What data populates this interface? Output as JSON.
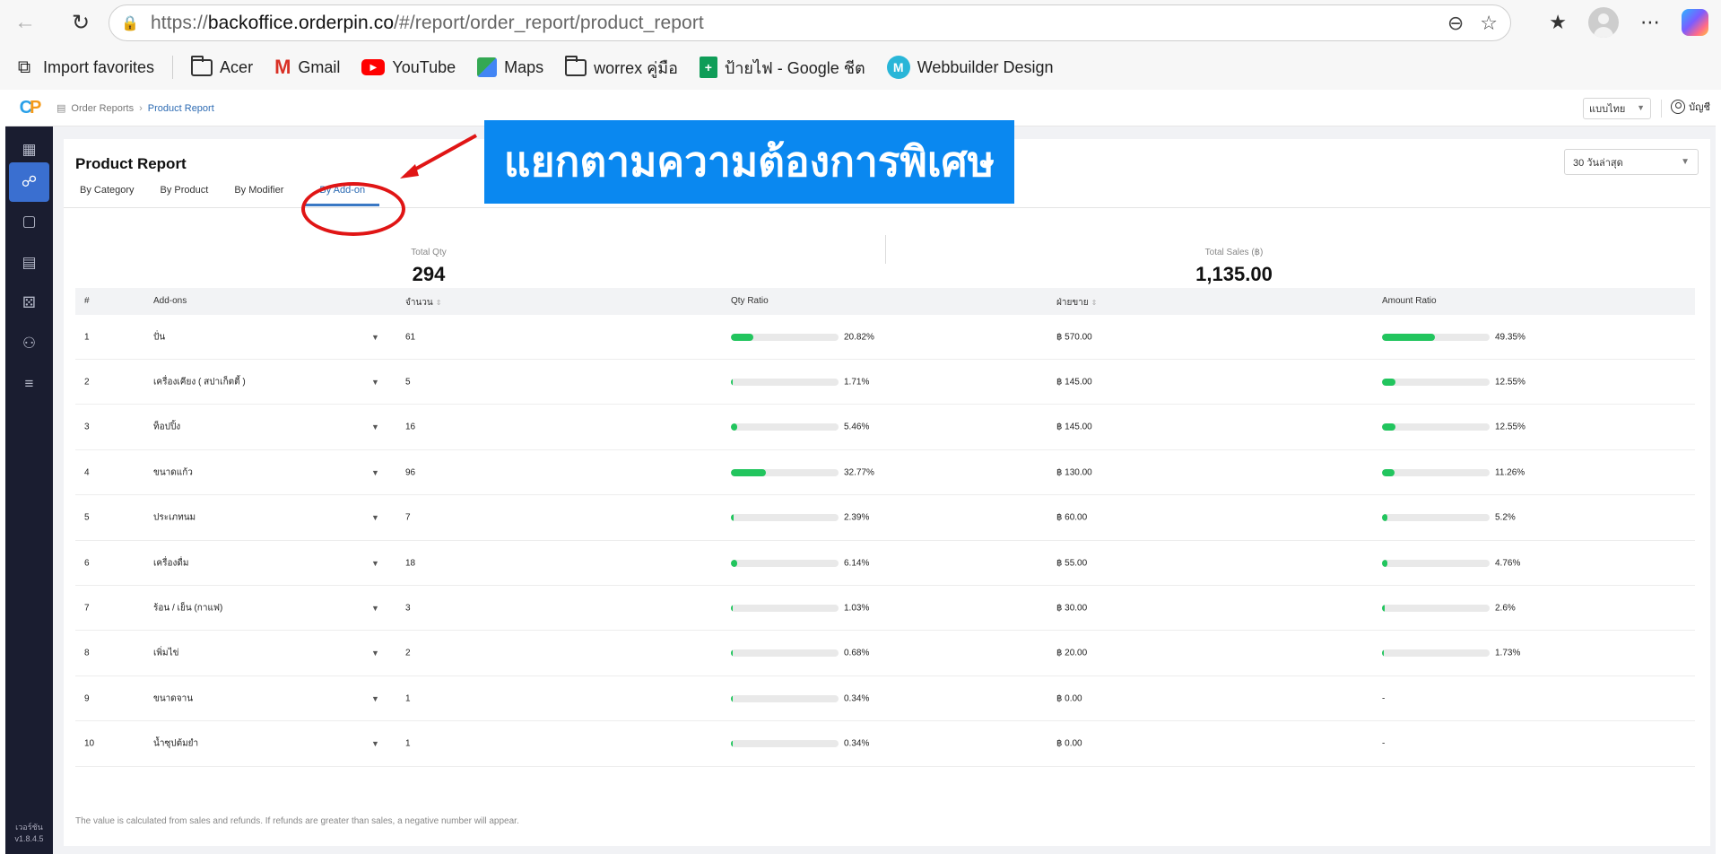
{
  "browser": {
    "url_prefix": "https://",
    "url_host": "backoffice.orderpin.co",
    "url_path": "/#/report/order_report/product_report",
    "bookmarks": [
      {
        "label": "Import favorites",
        "icon": "import-icon"
      },
      {
        "label": "Acer",
        "icon": "folder-icon"
      },
      {
        "label": "Gmail",
        "icon": "gmail-icon"
      },
      {
        "label": "YouTube",
        "icon": "youtube-icon"
      },
      {
        "label": "Maps",
        "icon": "maps-icon"
      },
      {
        "label": "worrex คู่มือ",
        "icon": "folder-icon"
      },
      {
        "label": "ป้ายไฟ - Google ชีต",
        "icon": "sheets-icon"
      },
      {
        "label": "Webbuilder Design",
        "icon": "webbuilder-icon"
      }
    ]
  },
  "header": {
    "breadcrumb": [
      "Order Reports",
      "Product Report"
    ],
    "language": "แบบไทย",
    "account": "บัญชี"
  },
  "sidebar": {
    "items": [
      "grid-icon",
      "report-icon",
      "bag-icon",
      "list-icon",
      "users-icon",
      "user-settings-icon",
      "sliders-icon"
    ],
    "active_index": 1,
    "version_label": "เวอร์ชัน",
    "version": "v1.8.4.5"
  },
  "page": {
    "title": "Product Report",
    "tabs": [
      "By Category",
      "By Product",
      "By Modifier",
      "By Add-on"
    ],
    "active_tab": 3,
    "date_range": "30 วันล่าสุด",
    "callout": "แยกตามความต้องการพิเศษ",
    "stats": {
      "total_qty_label": "Total Qty",
      "total_qty": "294",
      "total_sales_label": "Total Sales (฿)",
      "total_sales": "1,135.00"
    },
    "columns": [
      "#",
      "Add-ons",
      "จำนวน",
      "Qty Ratio",
      "ฝ่ายขาย",
      "Amount Ratio"
    ],
    "rows": [
      {
        "no": "1",
        "name": "ปั่น",
        "qty": "61",
        "qty_ratio": "20.82%",
        "qty_fill": 0.2082,
        "sales": "฿ 570.00",
        "amount_ratio": "49.35%",
        "amount_fill": 0.4935
      },
      {
        "no": "2",
        "name": "เครื่องเคียง ( สปาเก็ตตี้ )",
        "qty": "5",
        "qty_ratio": "1.71%",
        "qty_fill": 0.0171,
        "sales": "฿ 145.00",
        "amount_ratio": "12.55%",
        "amount_fill": 0.1255
      },
      {
        "no": "3",
        "name": "ท็อปปิ้ง",
        "qty": "16",
        "qty_ratio": "5.46%",
        "qty_fill": 0.0546,
        "sales": "฿ 145.00",
        "amount_ratio": "12.55%",
        "amount_fill": 0.1255
      },
      {
        "no": "4",
        "name": "ขนาดแก้ว",
        "qty": "96",
        "qty_ratio": "32.77%",
        "qty_fill": 0.3277,
        "sales": "฿ 130.00",
        "amount_ratio": "11.26%",
        "amount_fill": 0.1126
      },
      {
        "no": "5",
        "name": "ประเภทนม",
        "qty": "7",
        "qty_ratio": "2.39%",
        "qty_fill": 0.0239,
        "sales": "฿ 60.00",
        "amount_ratio": "5.2%",
        "amount_fill": 0.052
      },
      {
        "no": "6",
        "name": "เครื่องดื่ม",
        "qty": "18",
        "qty_ratio": "6.14%",
        "qty_fill": 0.0614,
        "sales": "฿ 55.00",
        "amount_ratio": "4.76%",
        "amount_fill": 0.0476
      },
      {
        "no": "7",
        "name": "ร้อน / เย็น (กาแฟ)",
        "qty": "3",
        "qty_ratio": "1.03%",
        "qty_fill": 0.0103,
        "sales": "฿ 30.00",
        "amount_ratio": "2.6%",
        "amount_fill": 0.026
      },
      {
        "no": "8",
        "name": "เพิ่มไข่",
        "qty": "2",
        "qty_ratio": "0.68%",
        "qty_fill": 0.0068,
        "sales": "฿ 20.00",
        "amount_ratio": "1.73%",
        "amount_fill": 0.0173
      },
      {
        "no": "9",
        "name": "ขนาดจาน",
        "qty": "1",
        "qty_ratio": "0.34%",
        "qty_fill": 0.0034,
        "sales": "฿ 0.00",
        "amount_ratio": "-",
        "amount_fill": null
      },
      {
        "no": "10",
        "name": "น้ำซุปต้มยำ",
        "qty": "1",
        "qty_ratio": "0.34%",
        "qty_fill": 0.0034,
        "sales": "฿ 0.00",
        "amount_ratio": "-",
        "amount_fill": null
      }
    ],
    "footnote": "The value is calculated from sales and refunds. If refunds are greater than sales, a negative number will appear."
  },
  "colors": {
    "accent": "#3a6fd0",
    "bar_fill": "#22c55e",
    "callout_bg": "#0a88f0",
    "annotation": "#e01515"
  }
}
